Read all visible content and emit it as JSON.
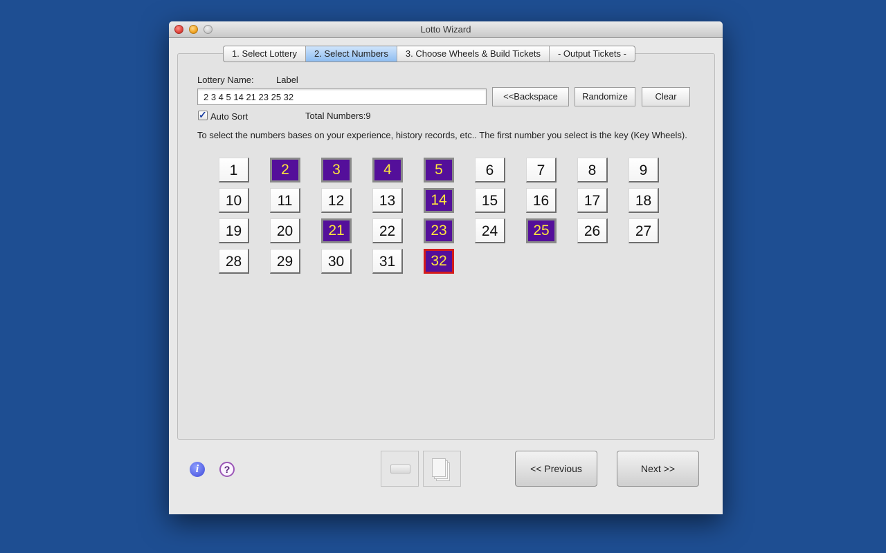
{
  "window": {
    "title": "Lotto Wizard"
  },
  "tabs": [
    {
      "label": "1. Select Lottery",
      "active": false
    },
    {
      "label": "2. Select Numbers",
      "active": true
    },
    {
      "label": "3. Choose Wheels & Build Tickets",
      "active": false
    },
    {
      "label": "- Output Tickets -",
      "active": false
    }
  ],
  "lottery": {
    "name_label": "Lottery Name:",
    "name_value": "Label"
  },
  "numbers_input": {
    "value": "2 3 4 5 14 21 23 25 32"
  },
  "buttons": {
    "backspace": "<<Backspace",
    "randomize": "Randomize",
    "clear": "Clear"
  },
  "auto_sort": {
    "label": "Auto Sort",
    "checked": true
  },
  "total": {
    "label": "Total Numbers:9"
  },
  "instructions": "To select the numbers bases on your experience, history records, etc.. The first number you select is the key (Key Wheels).",
  "grid": {
    "numbers": [
      "1",
      "2",
      "3",
      "4",
      "5",
      "6",
      "7",
      "8",
      "9",
      "10",
      "11",
      "12",
      "13",
      "14",
      "15",
      "16",
      "17",
      "18",
      "19",
      "20",
      "21",
      "22",
      "23",
      "24",
      "25",
      "26",
      "27",
      "28",
      "29",
      "30",
      "31",
      "32"
    ],
    "selected": [
      "2",
      "3",
      "4",
      "5",
      "14",
      "21",
      "23",
      "25"
    ],
    "key": "32"
  },
  "icons": {
    "info": "info-icon",
    "help": "help-icon",
    "keyboard": "keyboard-icon",
    "copy": "copy-pages-icon"
  },
  "footer": {
    "info_glyph": "i",
    "help_glyph": "?",
    "previous": "<< Previous",
    "next": "Next >>"
  },
  "colors": {
    "selected_bg": "#540f9a",
    "selected_text": "#ffe63c",
    "key_border": "#d41c1c",
    "desktop": "#1e4e92"
  }
}
